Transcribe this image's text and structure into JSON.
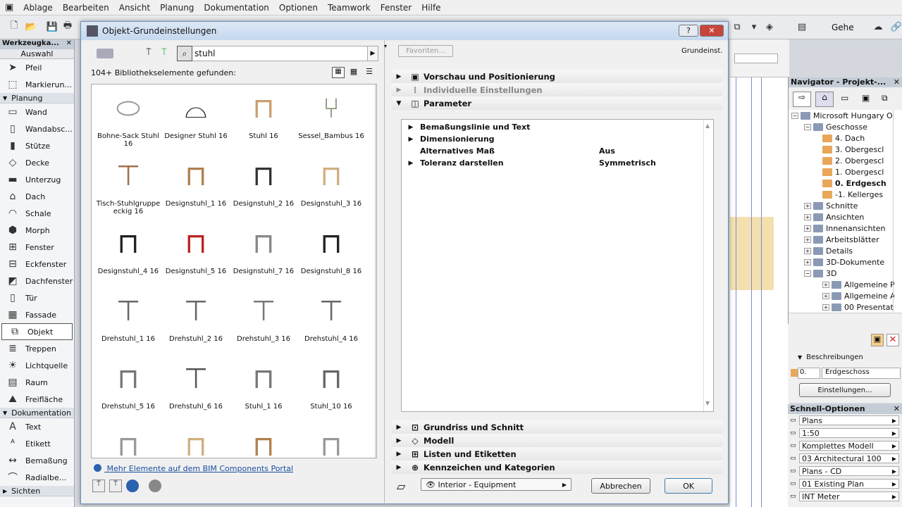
{
  "menubar": {
    "items": [
      "Ablage",
      "Bearbeiten",
      "Ansicht",
      "Planung",
      "Dokumentation",
      "Optionen",
      "Teamwork",
      "Fenster",
      "Hilfe"
    ]
  },
  "toolbar": {
    "view_label": "Gehe"
  },
  "toolbox": {
    "title": "Werkzeugka...",
    "select_label": "Auswahl",
    "items_top": [
      "Pfeil",
      "Markierun..."
    ],
    "group_planung": "Planung",
    "items_planung": [
      {
        "label": "Wand",
        "icon": "wall-icon"
      },
      {
        "label": "Wandabsc...",
        "icon": "wall-end-icon"
      },
      {
        "label": "Stütze",
        "icon": "column-icon"
      },
      {
        "label": "Decke",
        "icon": "slab-icon"
      },
      {
        "label": "Unterzug",
        "icon": "beam-icon"
      },
      {
        "label": "Dach",
        "icon": "roof-icon"
      },
      {
        "label": "Schale",
        "icon": "shell-icon"
      },
      {
        "label": "Morph",
        "icon": "morph-icon"
      },
      {
        "label": "Fenster",
        "icon": "window-icon"
      },
      {
        "label": "Eckfenster",
        "icon": "corner-window-icon"
      },
      {
        "label": "Dachfenster",
        "icon": "skylight-icon"
      },
      {
        "label": "Tür",
        "icon": "door-icon"
      },
      {
        "label": "Fassade",
        "icon": "curtain-wall-icon"
      },
      {
        "label": "Objekt",
        "icon": "object-icon"
      },
      {
        "label": "Treppen",
        "icon": "stair-icon"
      },
      {
        "label": "Lichtquelle",
        "icon": "lamp-icon"
      },
      {
        "label": "Raum",
        "icon": "zone-icon"
      },
      {
        "label": "Freifläche",
        "icon": "mesh-icon"
      }
    ],
    "group_doku": "Dokumentation",
    "items_doku": [
      {
        "label": "Text",
        "icon": "text-icon"
      },
      {
        "label": "Etikett",
        "icon": "label-icon"
      },
      {
        "label": "Bemaßung",
        "icon": "dimension-icon"
      },
      {
        "label": "Radialbe...",
        "icon": "radial-dimension-icon"
      }
    ],
    "group_sichten": "Sichten"
  },
  "dialog": {
    "title": "Objekt-Grundeinstellungen",
    "help_label": "?",
    "search_value": "stuhl",
    "found_text": "104+ Bibliothekselemente gefunden:",
    "favorites_label": "Favoriten...",
    "defaults_label": "Grundeinst.",
    "library_items": [
      "Bohne-Sack Stuhl 16",
      "Designer Stuhl 16",
      "Stuhl 16",
      "Sessel_Bambus 16",
      "Tisch-Stuhlgruppe eckig 16",
      "Designstuhl_1 16",
      "Designstuhl_2 16",
      "Designstuhl_3 16",
      "Designstuhl_4 16",
      "Designstuhl_5 16",
      "Designstuhl_7 16",
      "Designstuhl_8 16",
      "Drehstuhl_1 16",
      "Drehstuhl_2 16",
      "Drehstuhl_3 16",
      "Drehstuhl_4 16",
      "Drehstuhl_5 16",
      "Drehstuhl_6 16",
      "Stuhl_1 16",
      "Stuhl_10 16",
      "",
      "",
      "",
      ""
    ],
    "bim_link": "Mehr Elemente auf dem BIM Components Portal",
    "sections_top": [
      "Vorschau und Positionierung",
      "Individuelle Einstellungen",
      "Parameter"
    ],
    "params": [
      {
        "name": "Bemaßungslinie und Text",
        "value": "",
        "expand": true
      },
      {
        "name": "Dimensionierung",
        "value": "",
        "expand": true
      },
      {
        "name": "Alternatives Maß",
        "value": "Aus",
        "expand": false
      },
      {
        "name": "Toleranz darstellen",
        "value": "Symmetrisch",
        "expand": true
      }
    ],
    "sections_bottom": [
      "Grundriss und Schnitt",
      "Modell",
      "Listen und Etiketten",
      "Kennzeichen und Kategorien"
    ],
    "layer_value": "Interior - Equipment",
    "cancel_label": "Abbrechen",
    "ok_label": "OK"
  },
  "navigator": {
    "title": "Navigator - Projekt-...",
    "tree": [
      {
        "label": "Microsoft Hungary O",
        "indent": 0,
        "bold": false
      },
      {
        "label": "Geschosse",
        "indent": 1,
        "bold": false
      },
      {
        "label": "4. Dach",
        "indent": 2,
        "bold": false
      },
      {
        "label": "3. Obergescl",
        "indent": 2,
        "bold": false
      },
      {
        "label": "2. Obergescl",
        "indent": 2,
        "bold": false
      },
      {
        "label": "1. Obergescl",
        "indent": 2,
        "bold": false
      },
      {
        "label": "0. Erdgesch",
        "indent": 2,
        "bold": true
      },
      {
        "label": "-1. Kellerges",
        "indent": 2,
        "bold": false
      },
      {
        "label": "Schnitte",
        "indent": 1,
        "bold": false
      },
      {
        "label": "Ansichten",
        "indent": 1,
        "bold": false
      },
      {
        "label": "Innenansichten",
        "indent": 1,
        "bold": false
      },
      {
        "label": "Arbeitsblätter",
        "indent": 1,
        "bold": false
      },
      {
        "label": "Details",
        "indent": 1,
        "bold": false
      },
      {
        "label": "3D-Dokumente",
        "indent": 1,
        "bold": false
      },
      {
        "label": "3D",
        "indent": 1,
        "bold": false
      },
      {
        "label": "Allgemeine P",
        "indent": 2,
        "bold": false
      },
      {
        "label": "Allgemeine A",
        "indent": 2,
        "bold": false
      },
      {
        "label": "00 Presentat",
        "indent": 2,
        "bold": false
      }
    ],
    "desc_title": "Beschreibungen",
    "desc_num": "0.",
    "desc_value": "Erdgeschoss",
    "settings_label": "Einstellungen..."
  },
  "quick_options": {
    "title": "Schnell-Optionen",
    "rows": [
      "Plans",
      "1:50",
      "Komplettes Modell",
      "03 Architectural 100",
      "Plans - CD",
      "01 Existing Plan",
      "INT Meter"
    ]
  },
  "colors": {
    "accent": "#2b62b0",
    "folder": "#e8a75a",
    "titlebar": "#c5d8ee"
  }
}
